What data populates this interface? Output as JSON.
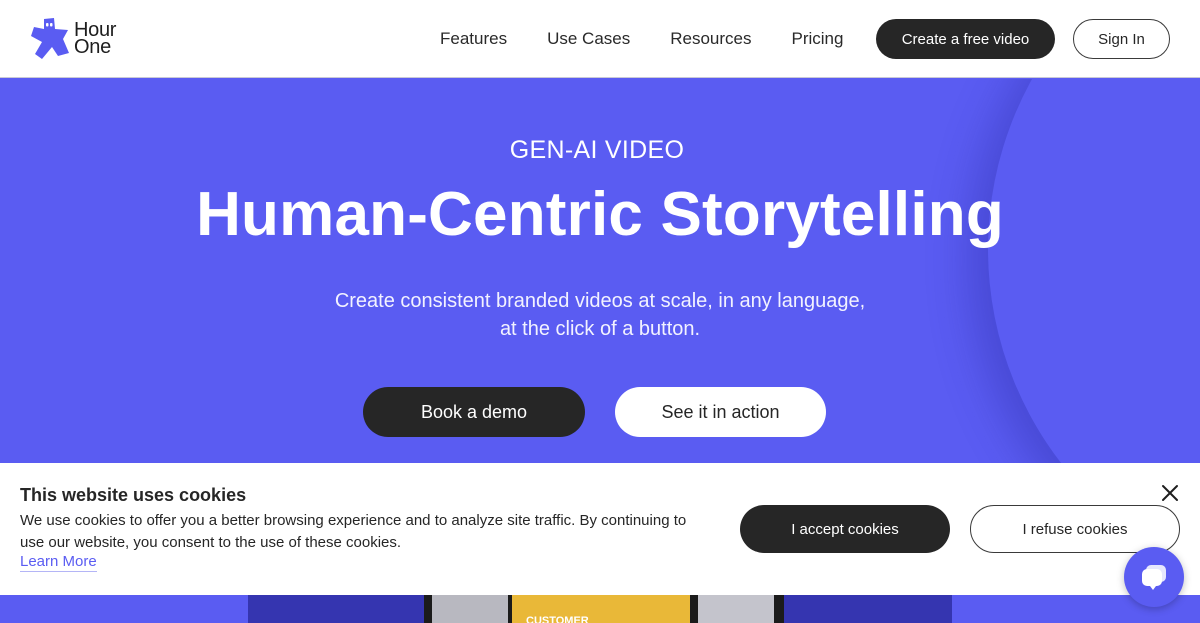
{
  "header": {
    "logo_line1": "Hour",
    "logo_line2": "One",
    "nav": [
      "Features",
      "Use Cases",
      "Resources",
      "Pricing"
    ],
    "create_label": "Create a free video",
    "signin_label": "Sign In"
  },
  "hero": {
    "eyebrow": "GEN-AI VIDEO",
    "title": "Human-Centric Storytelling",
    "subtitle_line1": "Create consistent branded videos at scale, in any language,",
    "subtitle_line2": "at the click of a button.",
    "demo_label": "Book a demo",
    "action_label": "See it in action"
  },
  "preview": {
    "card_text": "CUSTOMER"
  },
  "cookie": {
    "title": "This website uses cookies",
    "text": "We use cookies to offer you a better browsing experience and to analyze site traffic. By continuing to use our website, you consent to the use of these cookies.",
    "learn_more": "Learn More",
    "accept_label": "I accept cookies",
    "refuse_label": "I refuse cookies"
  },
  "colors": {
    "brand": "#5a5cf2",
    "dark": "#262626",
    "white": "#ffffff"
  }
}
